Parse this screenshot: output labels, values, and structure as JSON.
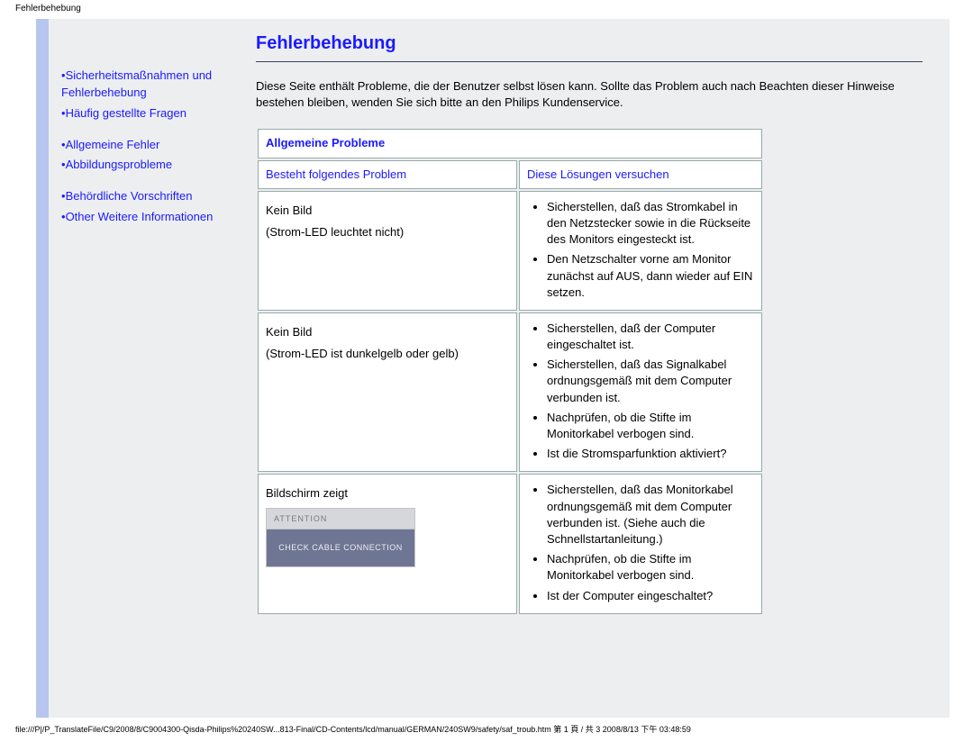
{
  "header": {
    "title": "Fehlerbehebung"
  },
  "sidebar": {
    "items": [
      {
        "label": "Sicherheitsmaßnahmen und Fehlerbehebung"
      },
      {
        "label": "Häufig gestellte Fragen"
      },
      {
        "label": "Allgemeine Fehler"
      },
      {
        "label": "Abbildungsprobleme"
      },
      {
        "label": "Behördliche Vorschriften"
      },
      {
        "label": "Other Weitere Informationen"
      }
    ]
  },
  "main": {
    "title": "Fehlerbehebung",
    "intro": "Diese Seite enthält Probleme, die der Benutzer selbst lösen kann. Sollte das Problem auch nach Beachten dieser Hinweise bestehen bleiben, wenden Sie sich bitte an den Philips Kundenservice.",
    "table": {
      "section_title": "Allgemeine Probleme",
      "col1_head": "Besteht folgendes Problem",
      "col2_head": "Diese Lösungen versuchen",
      "rows": [
        {
          "problem_line1": "Kein Bild",
          "problem_line2": "Strom-LED leuchtet nicht",
          "solutions": [
            "Sicherstellen, daß das Stromkabel in den Netzstecker sowie in die Rückseite des Monitors eingesteckt ist.",
            "Den Netzschalter vorne am Monitor zunächst auf AUS, dann wieder auf EIN setzen."
          ]
        },
        {
          "problem_line1": "Kein Bild",
          "problem_line2": "Strom-LED ist dunkelgelb oder gelb)",
          "solutions": [
            "Sicherstellen, daß der Computer eingeschaltet ist.",
            "Sicherstellen, daß das Signalkabel ordnungsgemäß mit dem Computer verbunden ist.",
            "Nachprüfen, ob die Stifte im Monitorkabel verbogen sind.",
            "Ist die Stromsparfunktion aktiviert?"
          ]
        },
        {
          "problem_line1": "Bildschirm zeigt",
          "osd": {
            "attention": "ATTENTION",
            "message": "CHECK CABLE CONNECTION"
          },
          "solutions": [
            "Sicherstellen, daß das Monitorkabel ordnungsgemäß mit dem Computer verbunden ist. (Siehe auch die Schnellstartanleitung.)",
            "Nachprüfen, ob die Stifte im Monitorkabel verbogen sind.",
            "Ist der Computer eingeschaltet?"
          ]
        }
      ]
    }
  },
  "footer": {
    "text": "file:///P|/P_TranslateFile/C9/2008/8/C9004300-Qisda-Philips%20240SW...813-Final/CD-Contents/lcd/manual/GERMAN/240SW9/safety/saf_troub.htm 第 1 頁 / 共 3 2008/8/13 下午 03:48:59"
  }
}
